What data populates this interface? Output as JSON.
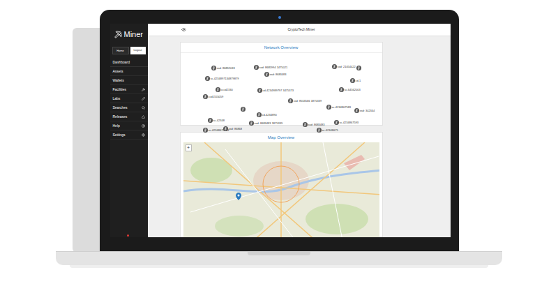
{
  "app": {
    "logo": "Miner",
    "title": "CryptoTech Miner"
  },
  "sidebar": {
    "buttons": [
      {
        "label": "Home",
        "selected": false
      },
      {
        "label": "Logout",
        "selected": true
      }
    ],
    "user": "Dashboard",
    "items": [
      {
        "label": "Assets"
      },
      {
        "label": "Wallets"
      },
      {
        "label": "Facilities"
      },
      {
        "label": "Labs"
      },
      {
        "label": "Searches"
      },
      {
        "label": "Releases"
      },
      {
        "label": "Help"
      },
      {
        "label": "Settings"
      }
    ]
  },
  "network": {
    "title": "Network Overview",
    "nodes": [
      {
        "label": "ssd: 86859033"
      },
      {
        "label": "ssd: 8685994 1475021"
      },
      {
        "label": "ssd: 21054422"
      },
      {
        "label": ""
      },
      {
        "label": "sc-4234897134879879"
      },
      {
        "label": "ssd: 8683483"
      },
      {
        "label": "cd-1"
      },
      {
        "label": "cccd2330"
      },
      {
        "label": "cd-4234989797 3475373"
      },
      {
        "label": "sc-64562003"
      },
      {
        "label": "ccd1555059"
      },
      {
        "label": "ssd: 8553566 1875339"
      },
      {
        "label": "sc-4234867583"
      },
      {
        "label": ""
      },
      {
        "label": "cd-4234890"
      },
      {
        "label": "ssd: 342344"
      },
      {
        "label": "sc-42348"
      },
      {
        "label": "ssd: 8683483 1875339"
      },
      {
        "label": "ssd: 8683483"
      },
      {
        "label": "sc-4234867593"
      },
      {
        "label": "sc-42348675673"
      },
      {
        "label": "ssd: 86868"
      },
      {
        "label": "sc-42348675"
      }
    ]
  },
  "map": {
    "title": "Map Overview",
    "zoom": "+"
  }
}
